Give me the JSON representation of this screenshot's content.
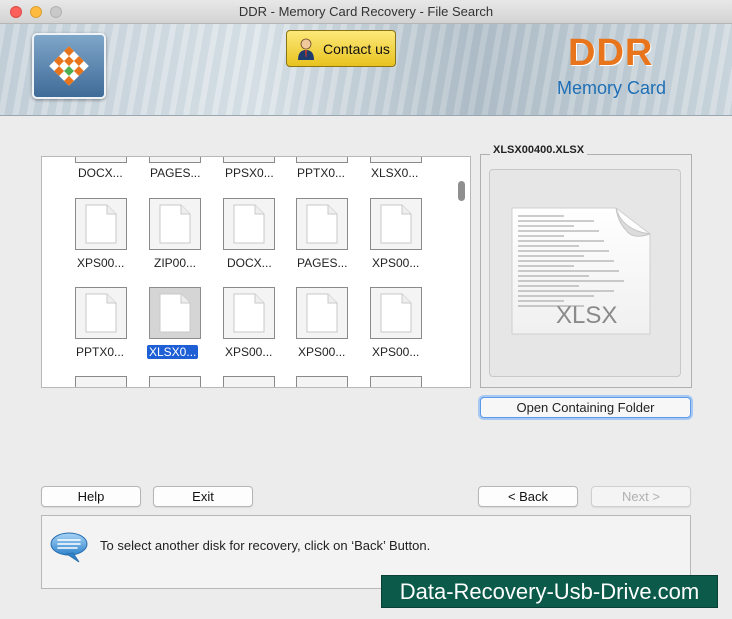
{
  "window": {
    "title": "DDR - Memory Card Recovery - File Search"
  },
  "header": {
    "contact_label": "Contact us",
    "brand_name": "DDR",
    "brand_sub": "Memory Card",
    "brand_color": "#e8751c",
    "sub_color": "#1f6fb6"
  },
  "files": {
    "row1": [
      "DOCX...",
      "PAGES...",
      "PPSX0...",
      "PPTX0...",
      "XLSX0..."
    ],
    "row2": [
      "XPS00...",
      "ZIP00...",
      "DOCX...",
      "PAGES...",
      "XPS00..."
    ],
    "row3": [
      "PPTX0...",
      "XLSX0...",
      "XPS00...",
      "XPS00...",
      "XPS00..."
    ],
    "selected": "XLSX0..."
  },
  "preview": {
    "title": "XLSX00400.XLSX",
    "file_type": "XLSX",
    "open_folder_label": "Open Containing Folder"
  },
  "buttons": {
    "help": "Help",
    "exit": "Exit",
    "back": "< Back",
    "next": "Next >"
  },
  "status": {
    "message": "To select another disk for recovery, click on ‘Back’ Button.",
    "icon": "speech-bubble-icon"
  },
  "watermark": "Data-Recovery-Usb-Drive.com"
}
